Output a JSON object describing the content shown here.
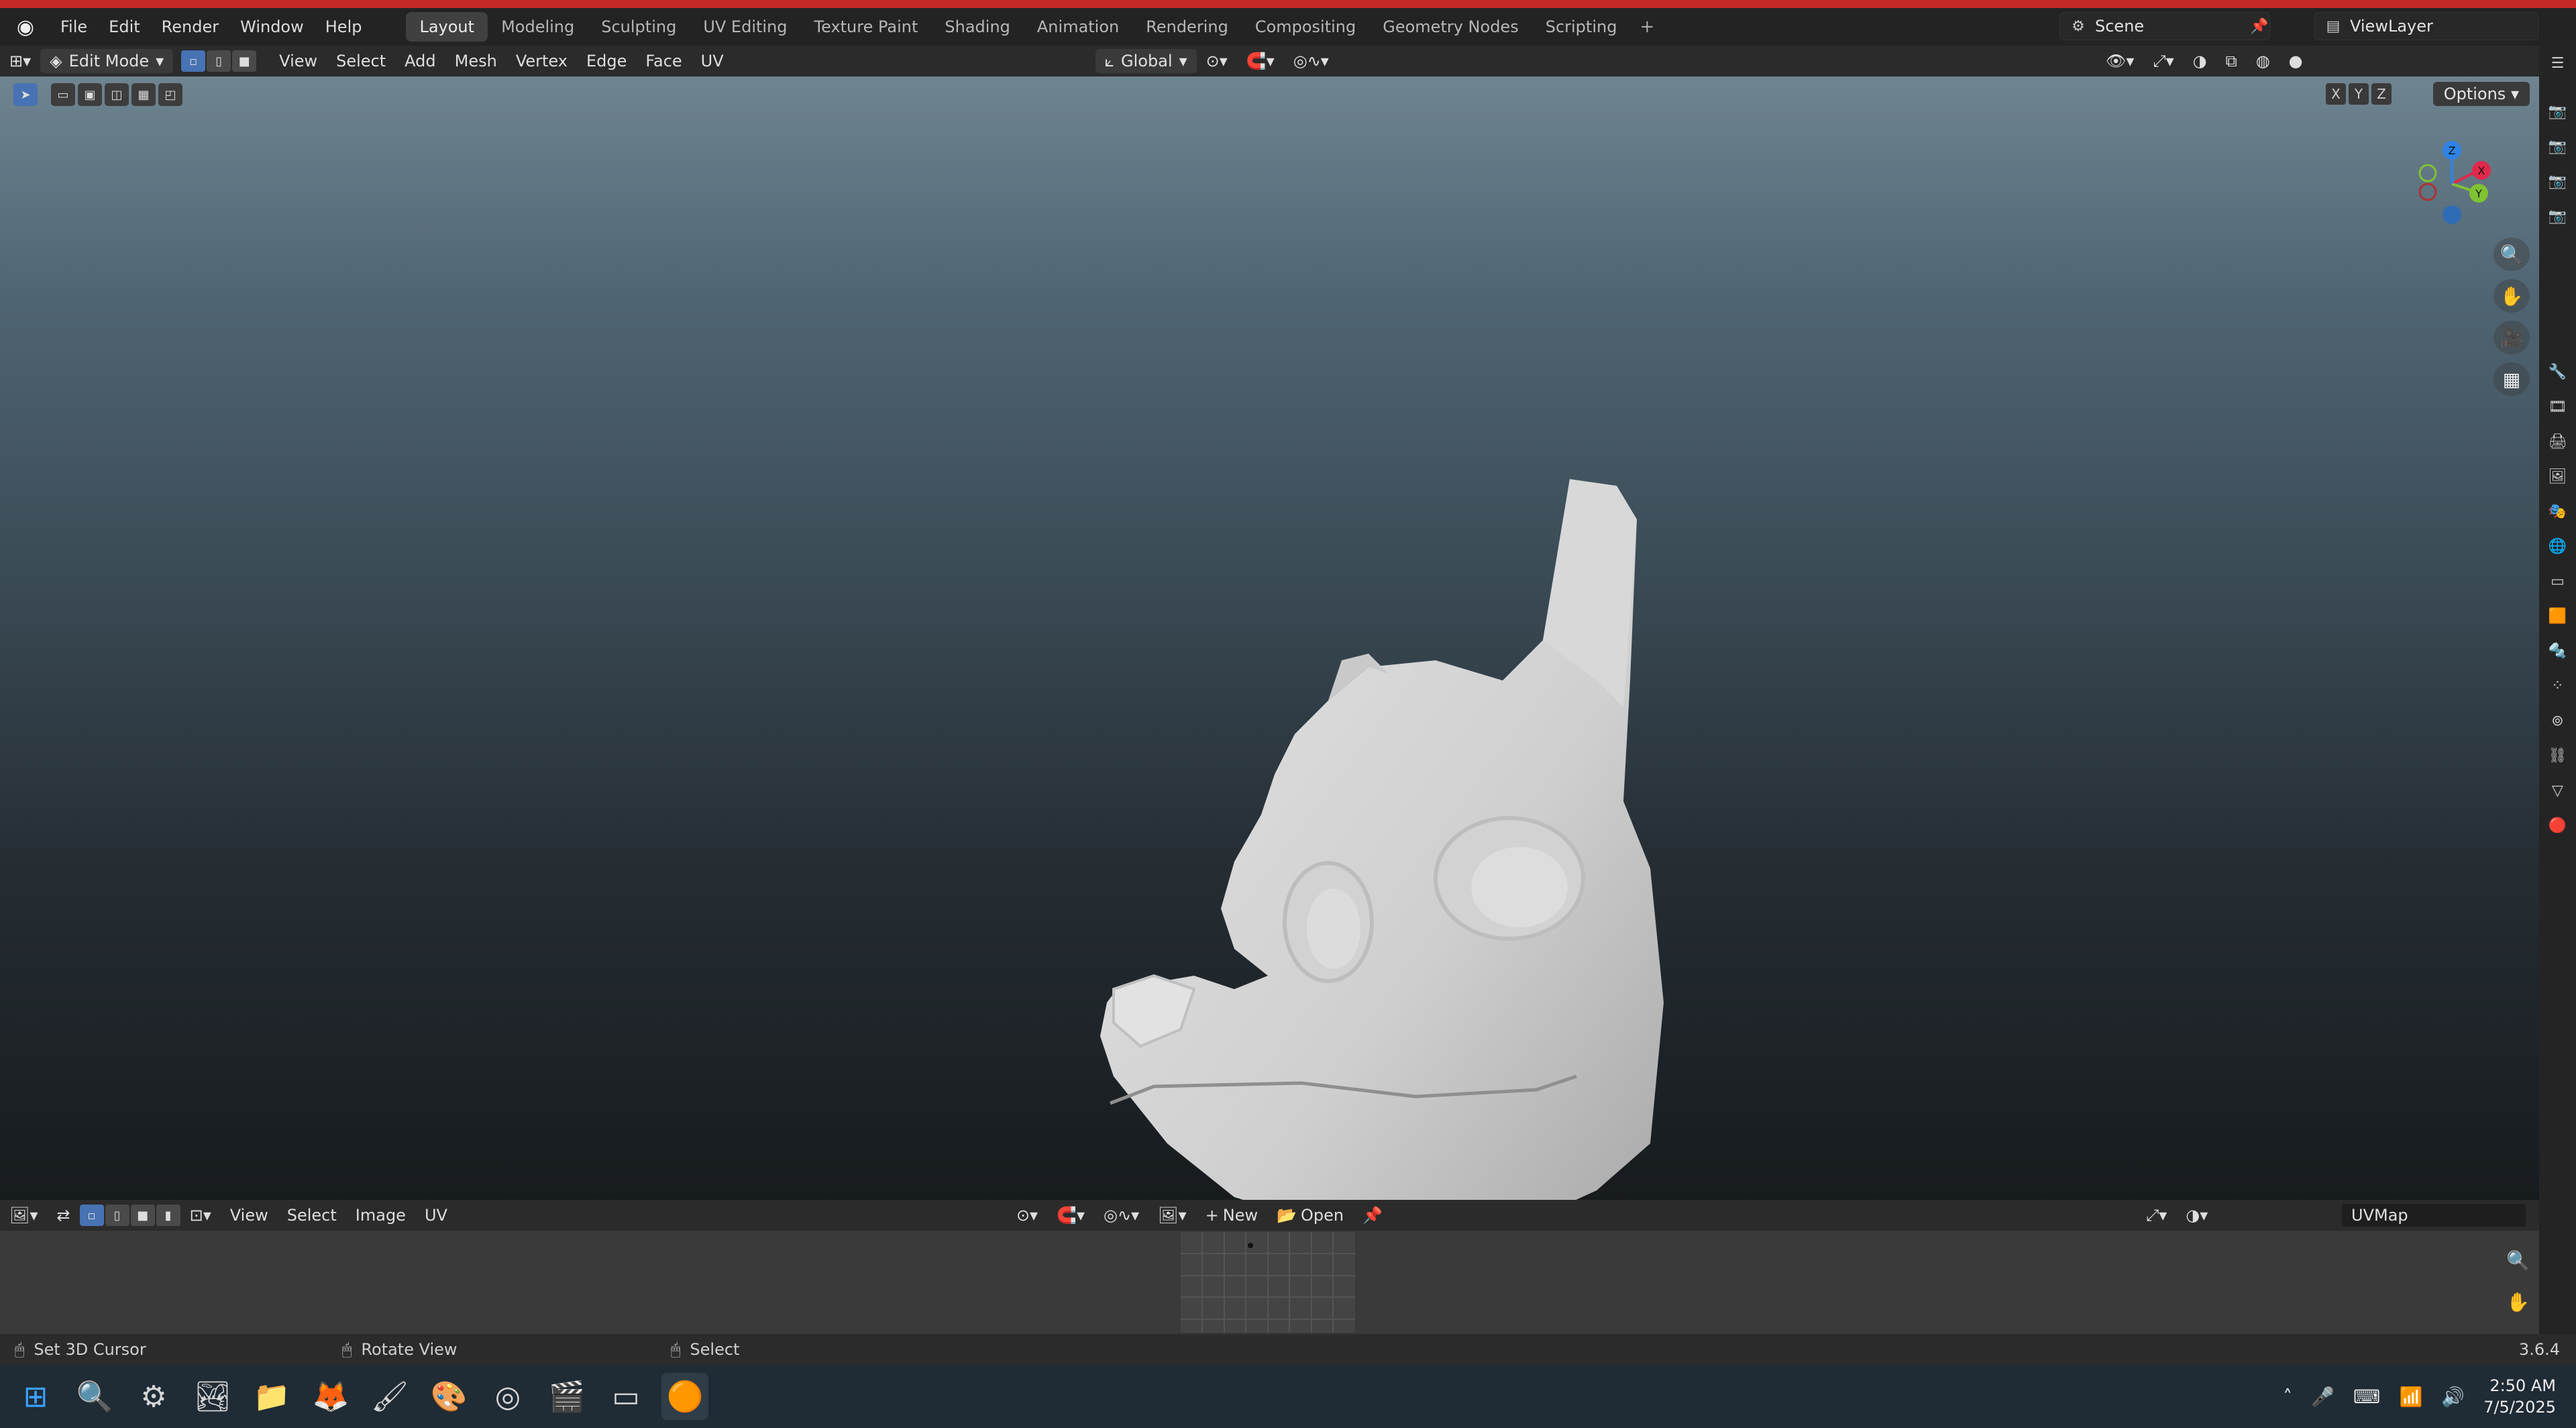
{
  "menubar": {
    "items": [
      "File",
      "Edit",
      "Render",
      "Window",
      "Help"
    ],
    "workspaces": [
      "Layout",
      "Modeling",
      "Sculpting",
      "UV Editing",
      "Texture Paint",
      "Shading",
      "Animation",
      "Rendering",
      "Compositing",
      "Geometry Nodes",
      "Scripting"
    ],
    "active_workspace": "Layout",
    "scene": "Scene",
    "view_layer": "ViewLayer"
  },
  "viewport_header": {
    "mode": "Edit Mode",
    "menus": [
      "View",
      "Select",
      "Add",
      "Mesh",
      "Vertex",
      "Edge",
      "Face",
      "UV"
    ],
    "transform_orientation": "Global",
    "options_label": "Options",
    "axis_labels": [
      "X",
      "Y",
      "Z"
    ]
  },
  "gizmo": {
    "x": "X",
    "y": "Y",
    "z": "Z"
  },
  "uv_editor": {
    "menus": [
      "View",
      "Select",
      "Image",
      "UV"
    ],
    "new_label": "New",
    "open_label": "Open",
    "uvmap": "UVMap"
  },
  "statusbar": {
    "left": "Set 3D Cursor",
    "middle": "Rotate View",
    "right": "Select",
    "version": "3.6.4"
  },
  "taskbar": {
    "time": "2:50 AM",
    "date": "7/5/2025"
  },
  "colors": {
    "accent": "#4772b3",
    "axis_x": "#e0294b",
    "axis_y": "#7fc232",
    "axis_z": "#2f83e5"
  }
}
